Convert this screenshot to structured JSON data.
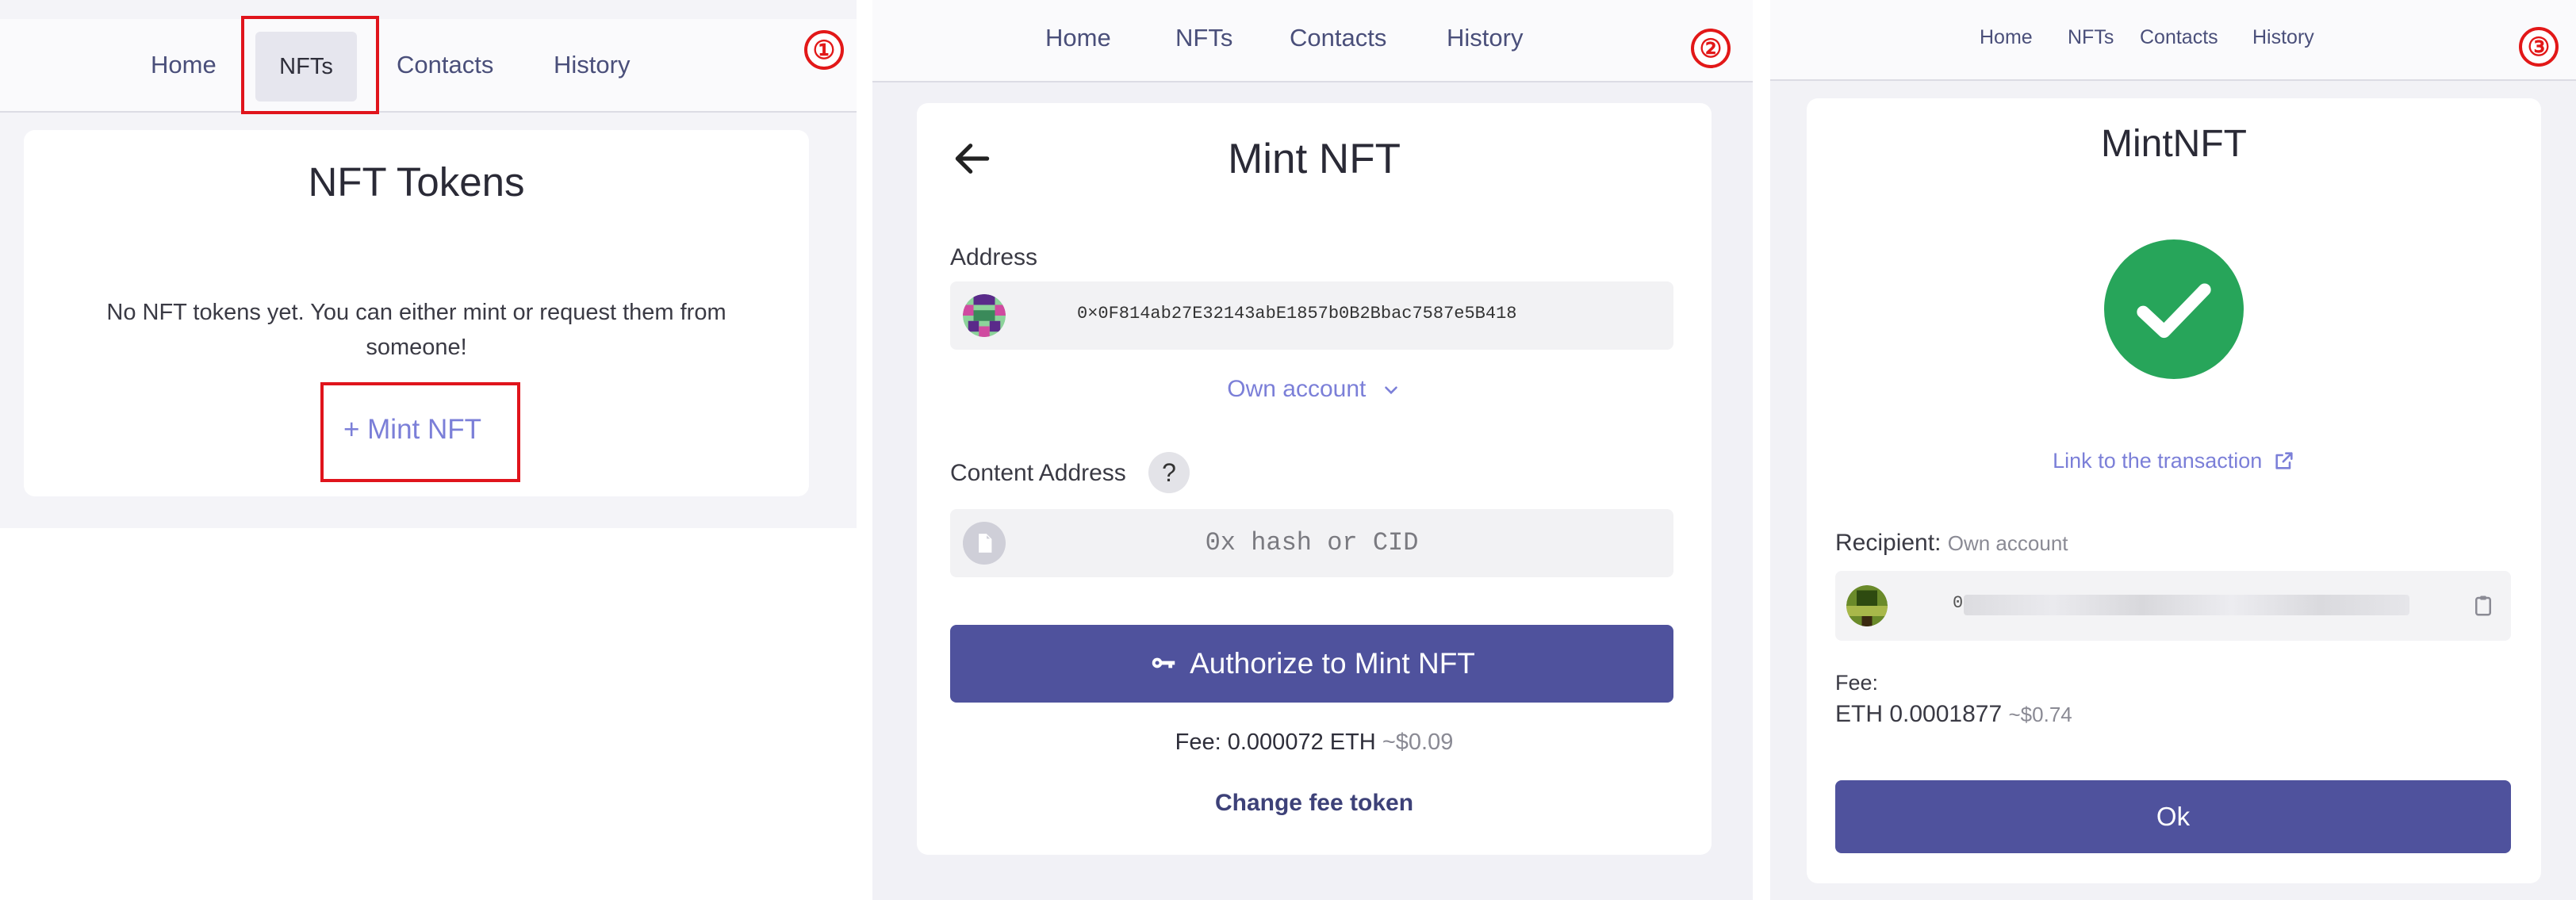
{
  "screen1": {
    "step": "①",
    "nav": [
      "Home",
      "NFTs",
      "Contacts",
      "History"
    ],
    "title": "NFT Tokens",
    "empty_message": "No NFT tokens yet. You can either mint or request them from someone!",
    "mint_link": "+ Mint NFT"
  },
  "screen2": {
    "step": "②",
    "nav": [
      "Home",
      "NFTs",
      "Contacts",
      "History"
    ],
    "title": "Mint NFT",
    "address_label": "Address",
    "address_value": "0×0F814ab27E32143abE1857b0B2Bbac7587e5B418",
    "own_account": "Own account",
    "content_label": "Content Address",
    "help_glyph": "?",
    "content_placeholder": "0x hash or CID",
    "authorize_label": "Authorize to Mint NFT",
    "fee_label": "Fee: 0.000072 ETH",
    "fee_usd": "~$0.09",
    "change_fee": "Change fee token"
  },
  "screen3": {
    "step": "③",
    "nav": [
      "Home",
      "NFTs",
      "Contacts",
      "History"
    ],
    "title": "MintNFT",
    "tx_link": "Link to the transaction",
    "recipient_label": "Recipient:",
    "recipient_sub": "Own account",
    "recipient_prefix": "0",
    "fee_label": "Fee:",
    "fee_value": "ETH 0.0001877",
    "fee_usd": "~$0.74",
    "ok_label": "Ok"
  },
  "colors": {
    "accent": "#4f529d",
    "link": "#7b7fd8",
    "highlight": "#e0141c",
    "success": "#27a55a"
  },
  "icons": [
    "back-arrow-icon",
    "chevron-down-icon",
    "help-icon",
    "file-icon",
    "key-icon",
    "check-icon",
    "external-link-icon",
    "clipboard-icon",
    "avatar-icon"
  ]
}
